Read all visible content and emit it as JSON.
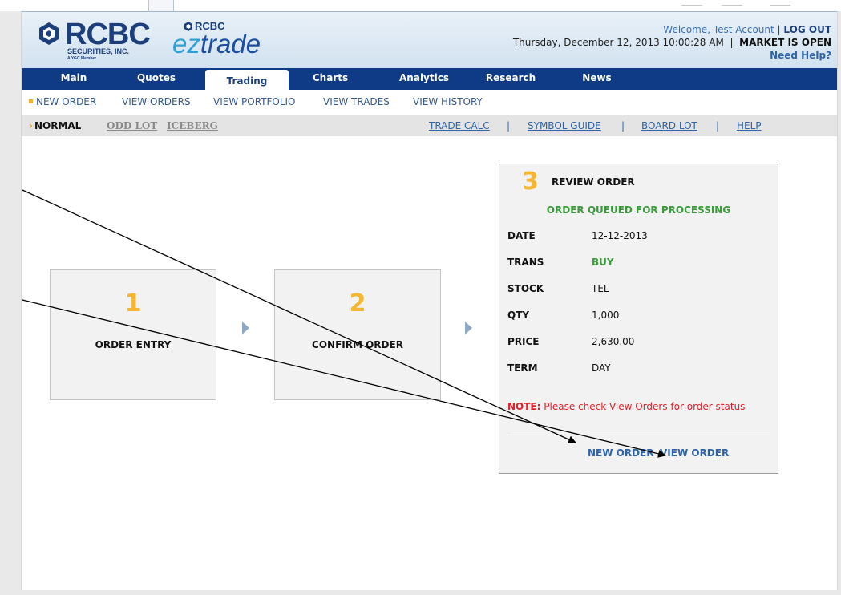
{
  "header": {
    "logo_rcbc": "RCBC",
    "logo_rcbc_sub": "SECURITIES, INC.",
    "logo_rcbc_mini": "A YGC Member",
    "logo_ez_brand": "RCBC",
    "logo_ez_word": "trade",
    "logo_ez_prefix": "ez",
    "welcome": "Welcome, Test Account",
    "logout": "LOG OUT",
    "datetime": "Thursday, December 12, 2013 10:00:28 AM",
    "market_status": "MARKET IS OPEN",
    "need_help": "Need Help?",
    "colors": {
      "nav": "#0f3b86",
      "accent": "#f5b733",
      "link": "#2d63a8",
      "green": "#3a9a3a",
      "red": "#e0202a"
    }
  },
  "mainnav": [
    "Main",
    "Quotes",
    "Trading",
    "Charts",
    "Analytics",
    "Research",
    "News"
  ],
  "subnav": [
    "NEW ORDER",
    "VIEW ORDERS",
    "VIEW PORTFOLIO",
    "VIEW TRADES",
    "VIEW HISTORY"
  ],
  "options": {
    "normal": "NORMAL",
    "odd_lot": "ODD LOT",
    "iceberg": "ICEBERG",
    "trade_calc": "TRADE CALC",
    "symbol_guide": "SYMBOL GUIDE",
    "board_lot": "BOARD LOT",
    "help": "HELP",
    "sep": "|"
  },
  "steps": [
    {
      "num": "1",
      "label": "ORDER ENTRY"
    },
    {
      "num": "2",
      "label": "CONFIRM ORDER"
    }
  ],
  "review": {
    "num": "3",
    "title": "REVIEW ORDER",
    "status": "ORDER QUEUED FOR PROCESSING",
    "rows": [
      {
        "k": "DATE",
        "v": "12-12-2013"
      },
      {
        "k": "TRANS",
        "v": "BUY"
      },
      {
        "k": "STOCK",
        "v": "TEL"
      },
      {
        "k": "QTY",
        "v": "1,000"
      },
      {
        "k": "PRICE",
        "v": "2,630.00"
      },
      {
        "k": "TERM",
        "v": "DAY"
      }
    ],
    "note_label": "NOTE:",
    "note_text": "Please check View Orders for order status",
    "new_order": "NEW ORDER",
    "view_order": "VIEW ORDER"
  }
}
